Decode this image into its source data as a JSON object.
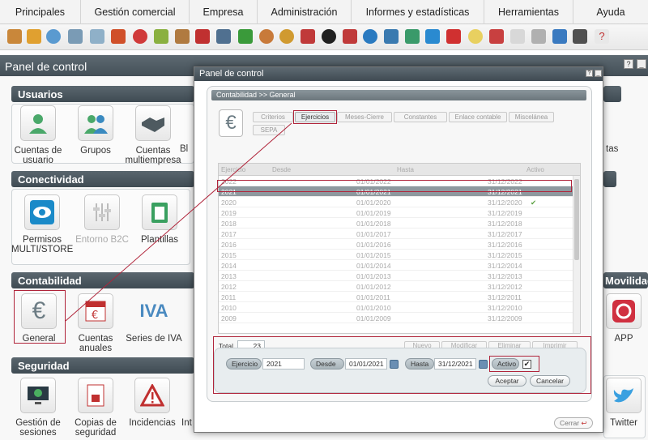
{
  "menu": [
    "Principales",
    "Gestión comercial",
    "Empresa",
    "Administración",
    "Informes y estadísticas",
    "Herramientas",
    "Ayuda"
  ],
  "panel_title": "Panel de control",
  "sections": {
    "usuarios": "Usuarios",
    "conectividad": "Conectividad",
    "contabilidad": "Contabilidad",
    "seguridad": "Seguridad",
    "movilidad": "Movilidad"
  },
  "items": {
    "cuentas_usuario": "Cuentas de usuario",
    "grupos": "Grupos",
    "cuentas_multi": "Cuentas multiempresa",
    "bl_partial": "Bl",
    "permisos": "Permisos MULTI/STORE",
    "entorno": "Entorno B2C",
    "plantillas": "Plantillas",
    "general": "General",
    "cuentas_anuales": "Cuentas anuales",
    "series_iva": "Series de IVA",
    "gestion_sesiones": "Gestión de sesiones",
    "copias": "Copias de seguridad",
    "incidencias": "Incidencias",
    "int_partial": "Int",
    "tas_partial": "tas",
    "app": "APP",
    "twitter": "Twitter"
  },
  "modal": {
    "title": "Panel de control",
    "breadcrumb": "Contabilidad >> General",
    "tabs": [
      "Criterios",
      "Ejercicios",
      "Meses-Cierre",
      "Constantes",
      "Enlace contable",
      "Miscelánea",
      "SEPA"
    ],
    "columns": [
      "Ejercicio",
      "Desde",
      "Hasta",
      "Activo"
    ],
    "rows": [
      [
        "2022",
        "01/01/2022",
        "31/12/2022"
      ],
      [
        "2021",
        "01/01/2021",
        "31/12/2021"
      ],
      [
        "2020",
        "01/01/2020",
        "31/12/2020"
      ],
      [
        "2019",
        "01/01/2019",
        "31/12/2019"
      ],
      [
        "2018",
        "01/01/2018",
        "31/12/2018"
      ],
      [
        "2017",
        "01/01/2017",
        "31/12/2017"
      ],
      [
        "2016",
        "01/01/2016",
        "31/12/2016"
      ],
      [
        "2015",
        "01/01/2015",
        "31/12/2015"
      ],
      [
        "2014",
        "01/01/2014",
        "31/12/2014"
      ],
      [
        "2013",
        "01/01/2013",
        "31/12/2013"
      ],
      [
        "2012",
        "01/01/2012",
        "31/12/2012"
      ],
      [
        "2011",
        "01/01/2011",
        "31/12/2011"
      ],
      [
        "2010",
        "01/01/2010",
        "31/12/2010"
      ],
      [
        "2009",
        "01/01/2009",
        "31/12/2009"
      ]
    ],
    "total_label": "Total",
    "total_value": "23",
    "actions": [
      "Nuevo",
      "Modificar",
      "Eliminar",
      "Imprimir"
    ],
    "form": {
      "ejercicio_label": "Ejercicio",
      "ejercicio": "2021",
      "desde_label": "Desde",
      "desde": "01/01/2021",
      "hasta_label": "Hasta",
      "hasta": "31/12/2021",
      "activo_label": "Activo"
    },
    "accept": "Aceptar",
    "cancel": "Cancelar",
    "close": "Cerrar"
  }
}
